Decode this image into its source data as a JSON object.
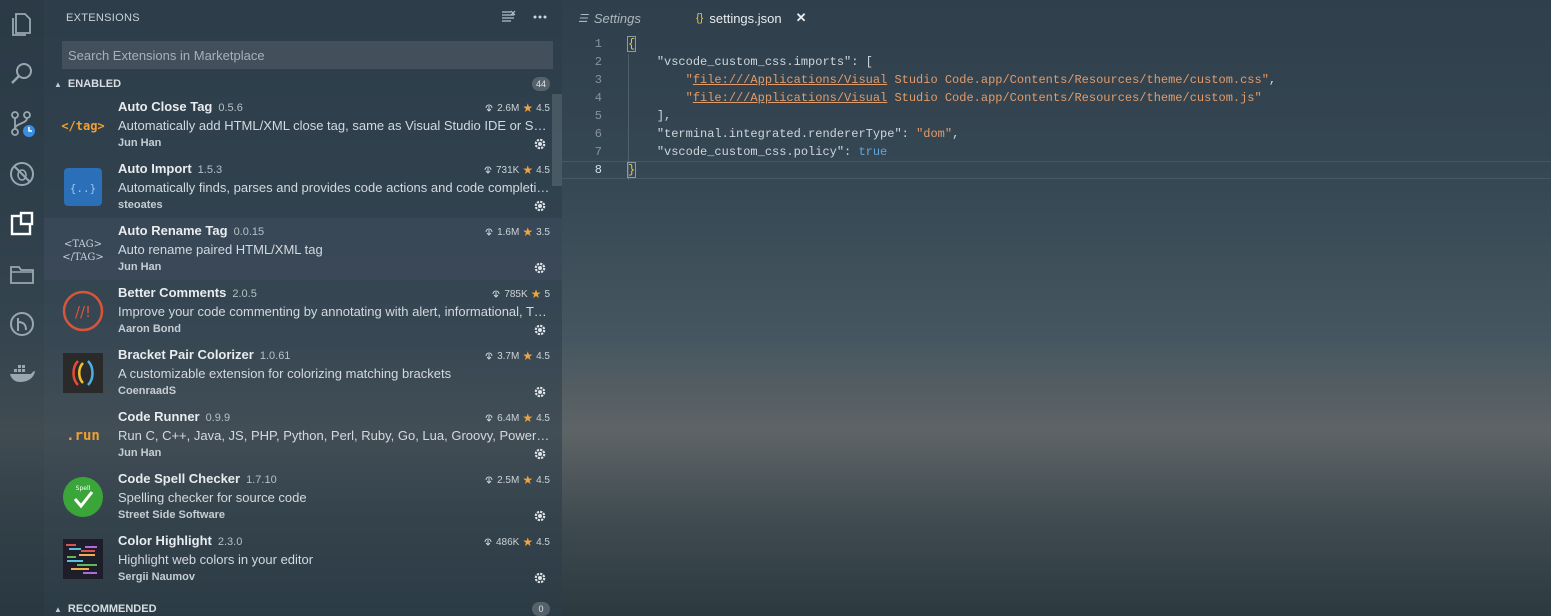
{
  "sidebar": {
    "title": "EXTENSIONS",
    "search_placeholder": "Search Extensions in Marketplace",
    "enabled_label": "ENABLED",
    "enabled_count": "44",
    "recommended_label": "RECOMMENDED",
    "recommended_count": "0",
    "extensions": [
      {
        "name": "Auto Close Tag",
        "version": "0.5.6",
        "description": "Automatically add HTML/XML close tag, same as Visual Studio IDE or Sublime Text",
        "author": "Jun Han",
        "downloads": "2.6M",
        "rating": "4.5"
      },
      {
        "name": "Auto Import",
        "version": "1.5.3",
        "description": "Automatically finds, parses and provides code actions and code completion for all available imports",
        "author": "steoates",
        "downloads": "731K",
        "rating": "4.5"
      },
      {
        "name": "Auto Rename Tag",
        "version": "0.0.15",
        "description": "Auto rename paired HTML/XML tag",
        "author": "Jun Han",
        "downloads": "1.6M",
        "rating": "3.5"
      },
      {
        "name": "Better Comments",
        "version": "2.0.5",
        "description": "Improve your code commenting by annotating with alert, informational, TODOs, and more!",
        "author": "Aaron Bond",
        "downloads": "785K",
        "rating": "5"
      },
      {
        "name": "Bracket Pair Colorizer",
        "version": "1.0.61",
        "description": "A customizable extension for colorizing matching brackets",
        "author": "CoenraadS",
        "downloads": "3.7M",
        "rating": "4.5"
      },
      {
        "name": "Code Runner",
        "version": "0.9.9",
        "description": "Run C, C++, Java, JS, PHP, Python, Perl, Ruby, Go, Lua, Groovy, PowerShell, CMD, BASH, F#, C#",
        "author": "Jun Han",
        "downloads": "6.4M",
        "rating": "4.5"
      },
      {
        "name": "Code Spell Checker",
        "version": "1.7.10",
        "description": "Spelling checker for source code",
        "author": "Street Side Software",
        "downloads": "2.5M",
        "rating": "4.5"
      },
      {
        "name": "Color Highlight",
        "version": "2.3.0",
        "description": "Highlight web colors in your editor",
        "author": "Sergii Naumov",
        "downloads": "486K",
        "rating": "4.5"
      }
    ]
  },
  "tabs": {
    "settings_label": "Settings",
    "json_label": "settings.json",
    "json_icon": "{}",
    "close_glyph": "✕"
  },
  "editor": {
    "line_numbers": [
      "1",
      "2",
      "3",
      "4",
      "5",
      "6",
      "7",
      "8"
    ],
    "tokens": {
      "l1_open": "{",
      "l2_key": "\"vscode_custom_css.imports\"",
      "l2_rest": ": [",
      "l3_q": "\"",
      "l3_link": "file:///Applications/Visual",
      "l3_rest": " Studio Code.app/Contents/Resources/theme/custom.css\"",
      "l3_comma": ",",
      "l4_q": "\"",
      "l4_link": "file:///Applications/Visual",
      "l4_rest": " Studio Code.app/Contents/Resources/theme/custom.js\"",
      "l5": "],",
      "l6_key": "\"terminal.integrated.rendererType\"",
      "l6_colon": ": ",
      "l6_val": "\"dom\"",
      "l6_comma": ",",
      "l7_key": "\"vscode_custom_css.policy\"",
      "l7_colon": ": ",
      "l7_val": "true",
      "l8_close": "}"
    }
  },
  "colors": {
    "rating_star": "#f2a33a",
    "string": "#e29b6a",
    "boolean": "#62a8d8",
    "bracket": "#e8c44a"
  }
}
